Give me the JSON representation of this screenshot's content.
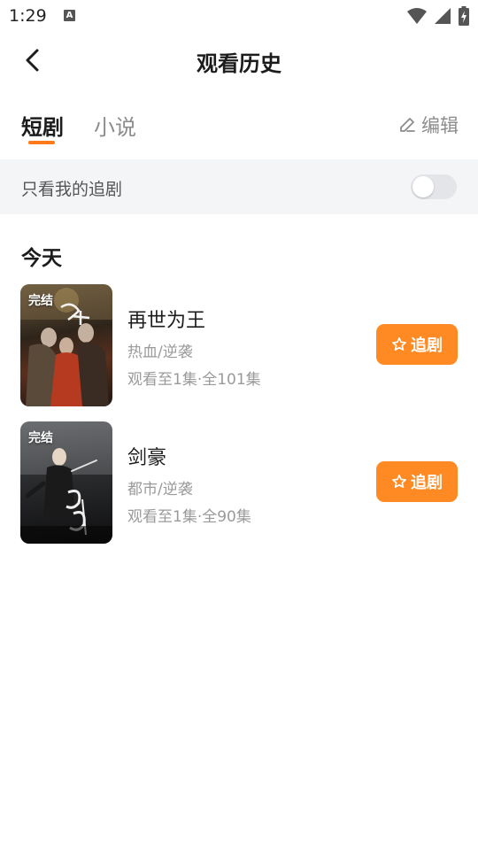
{
  "status_bar": {
    "time": "1:29",
    "notification_icon": "A"
  },
  "header": {
    "title": "观看历史",
    "back_icon": "chevron-left"
  },
  "tabs": [
    {
      "label": "短剧",
      "active": true
    },
    {
      "label": "小说",
      "active": false
    }
  ],
  "edit": {
    "label": "编辑",
    "icon": "pencil"
  },
  "filter": {
    "label": "只看我的追剧",
    "enabled": false
  },
  "section": {
    "title": "今天"
  },
  "items": [
    {
      "title": "再世为王",
      "genre": "热血/逆袭",
      "progress": "观看至1集·全101集",
      "badge": "完结",
      "follow_label": "追剧"
    },
    {
      "title": "剑豪",
      "genre": "都市/逆袭",
      "progress": "观看至1集·全90集",
      "badge": "完结",
      "follow_label": "追剧"
    }
  ],
  "colors": {
    "accent": "#ff8a23",
    "tab_indicator": "#ff7a1a",
    "filter_bg": "#f4f5f7"
  }
}
